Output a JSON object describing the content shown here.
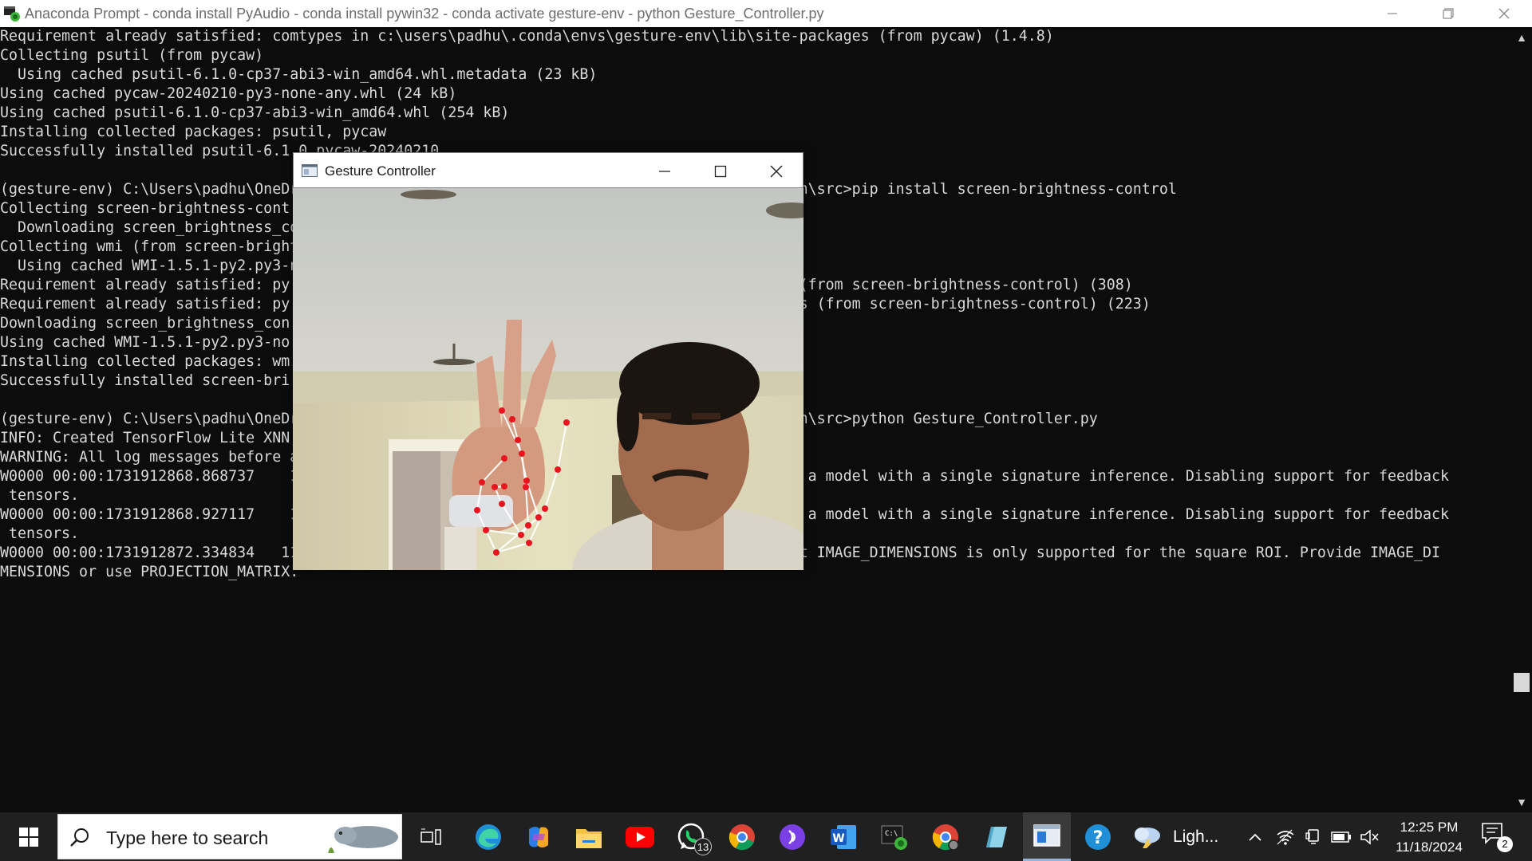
{
  "window": {
    "title": "Anaconda Prompt - conda  install PyAudio - conda  install pywin32 - conda  activate gesture-env - python  Gesture_Controller.py",
    "minimize_icon": "minimize-icon",
    "maximize_icon": "restore-icon",
    "close_icon": "close-icon"
  },
  "console": {
    "lines": [
      "Requirement already satisfied: comtypes in c:\\users\\padhu\\.conda\\envs\\gesture-env\\lib\\site-packages (from pycaw) (1.4.8)",
      "Collecting psutil (from pycaw)",
      "  Using cached psutil-6.1.0-cp37-abi3-win_amd64.whl.metadata (23 kB)",
      "Using cached pycaw-20240210-py3-none-any.whl (24 kB)",
      "Using cached psutil-6.1.0-cp37-abi3-win_amd64.whl (254 kB)",
      "Installing collected packages: psutil, pycaw",
      "Successfully installed psutil-6.1.0 pycaw-20240210",
      "",
      "(gesture-env) C:\\Users\\padhu\\OneDr                                                  use-main\\src>pip install screen-brightness-control",
      "Collecting screen-brightness-cont",
      "  Downloading screen_brightness_co",
      "Collecting wmi (from screen-bright",
      "  Using cached WMI-1.5.1-py2.py3-n",
      "Requirement already satisfied: py                                                  ackages (from screen-brightness-control) (308)",
      "Requirement already satisfied: py                                                  -packages (from screen-brightness-control) (223)",
      "Downloading screen_brightness_con",
      "Using cached WMI-1.5.1-py2.py3-no",
      "Installing collected packages: wm",
      "Successfully installed screen-bri",
      "",
      "(gesture-env) C:\\Users\\padhu\\OneDr                                                  use-main\\src>python Gesture_Controller.py",
      "INFO: Created TensorFlow Lite XNN",
      "WARNING: All log messages before a",
      "W0000 00:00:1731912868.868737    1                                                  equires a model with a single signature inference. Disabling support for feedback",
      " tensors.",
      "W0000 00:00:1731912868.927117    1                                                  equires a model with a single signature inference. Disabling support for feedback",
      " tensors.",
      "W0000 00:00:1731912872.334834   11                                                 ` without IMAGE_DIMENSIONS is only supported for the square ROI. Provide IMAGE_DI",
      "MENSIONS or use PROJECTION_MATRIX."
    ]
  },
  "gesture_window": {
    "title": "Gesture Controller",
    "icon": "window-app-icon"
  },
  "taskbar": {
    "start_icon": "windows-start-icon",
    "search_placeholder": "Type here to search",
    "apps": [
      {
        "name": "task-view-icon"
      },
      {
        "name": "edge-icon"
      },
      {
        "name": "copilot-icon"
      },
      {
        "name": "file-explorer-icon"
      },
      {
        "name": "youtube-icon"
      },
      {
        "name": "whatsapp-icon",
        "badge": "13"
      },
      {
        "name": "chrome-icon"
      },
      {
        "name": "podcast-app-icon"
      },
      {
        "name": "word-icon"
      },
      {
        "name": "anaconda-prompt-icon"
      },
      {
        "name": "chrome-profile-icon"
      },
      {
        "name": "notes-app-icon"
      },
      {
        "name": "gesture-controller-taskbar-icon",
        "active": true
      },
      {
        "name": "help-icon"
      }
    ],
    "weather": {
      "icon": "weather-storm-icon",
      "label": "Ligh..."
    },
    "tray": [
      "chevron-up-icon",
      "wifi-icon",
      "display-icon",
      "battery-icon",
      "volume-muted-icon"
    ],
    "clock": {
      "time": "12:25 PM",
      "date": "11/18/2024"
    },
    "notifications": {
      "icon": "notification-icon",
      "count": "2"
    }
  },
  "colors": {
    "console_bg": "#0c0c0c",
    "console_text": "#d9d9d9",
    "taskbar_bg": "#202020",
    "landmark": "#e8141e",
    "connector": "#ffffff"
  }
}
